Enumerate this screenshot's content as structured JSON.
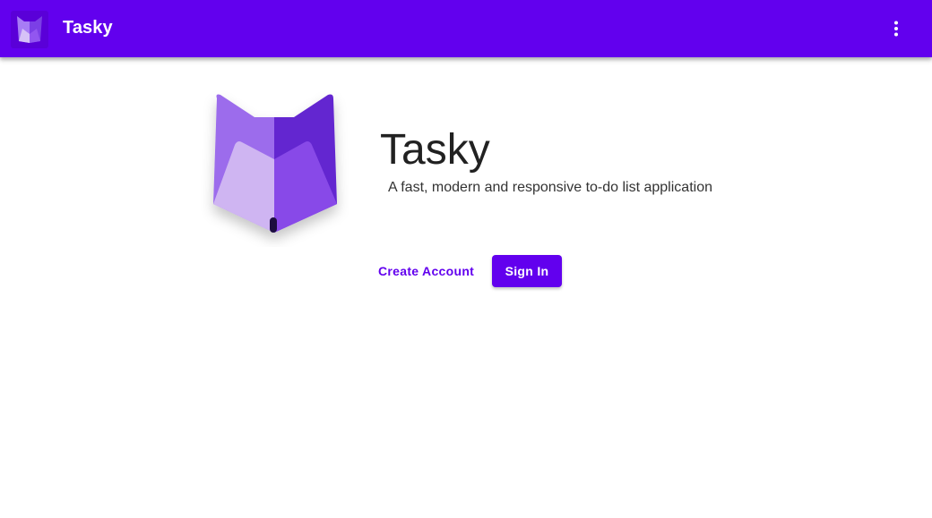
{
  "appbar": {
    "title": "Tasky",
    "logo_icon": "tasky-fox-logo-icon",
    "menu_icon": "more-vert-icon"
  },
  "hero": {
    "logo_icon": "tasky-fox-logo-icon",
    "title": "Tasky",
    "subtitle": "A fast, modern and responsive to-do list application"
  },
  "actions": {
    "create_account_label": "Create Account",
    "sign_in_label": "Sign In"
  },
  "colors": {
    "primary": "#6200ee",
    "logo_light": "#d0b6f2",
    "logo_mid": "#9c6ef0",
    "logo_dark": "#6a2fd6"
  }
}
